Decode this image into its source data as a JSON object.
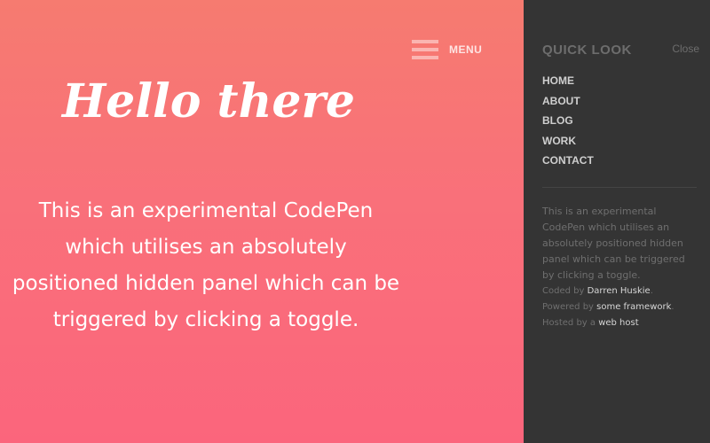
{
  "main": {
    "menu_label": "MENU",
    "title": "Hello there",
    "description": "This is an experimental CodePen which utilises an absolutely positioned hidden panel which can be triggered by clicking a toggle."
  },
  "panel": {
    "title": "QUICK LOOK",
    "close_label": "Close",
    "nav": [
      "HOME",
      "ABOUT",
      "BLOG",
      "WORK",
      "CONTACT"
    ],
    "description": "This is an experimental CodePen which utilises an absolutely positioned hidden panel which can be triggered by clicking a toggle.",
    "credits": {
      "coded_prefix": "Coded by ",
      "coded_link": "Darren Huskie",
      "coded_suffix": ".",
      "powered_prefix": "Powered by ",
      "powered_link": "some framework",
      "powered_suffix": ".",
      "hosted_prefix": "Hosted by a ",
      "hosted_link": "web host",
      "hosted_suffix": ""
    }
  },
  "colors": {
    "gradient_top": "#f67b70",
    "gradient_bottom": "#fb657c",
    "panel_background": "#343434"
  },
  "icons": {
    "menu_toggle": "hamburger-icon"
  }
}
